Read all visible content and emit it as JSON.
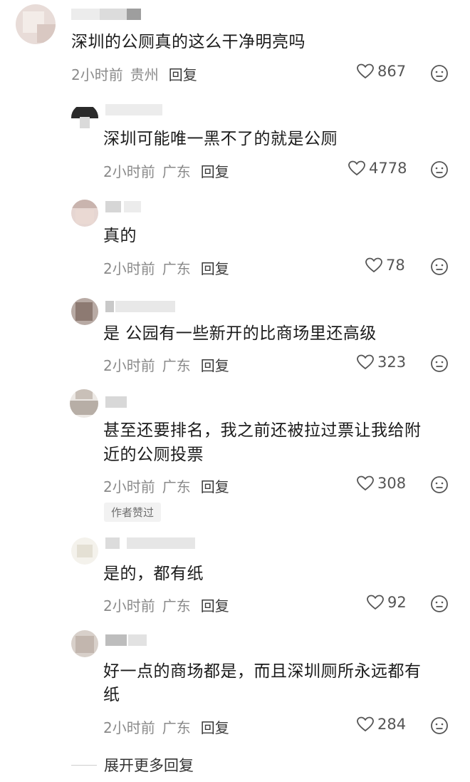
{
  "comments": [
    {
      "text": "深圳的公厕真的这么干净明亮吗",
      "time": "2小时前",
      "location": "贵州",
      "reply_label": "回复",
      "likes": "867"
    },
    {
      "text": "深圳可能唯一黑不了的就是公厕",
      "time": "2小时前",
      "location": "广东",
      "reply_label": "回复",
      "likes": "4778"
    },
    {
      "text": "真的",
      "time": "2小时前",
      "location": "广东",
      "reply_label": "回复",
      "likes": "78"
    },
    {
      "text": "是 公园有一些新开的比商场里还高级",
      "time": "2小时前",
      "location": "广东",
      "reply_label": "回复",
      "likes": "323"
    },
    {
      "text_line1": "甚至还要排名，我之前还被拉过票让我给附",
      "text_line2": "近的公厕投票",
      "time": "2小时前",
      "location": "广东",
      "reply_label": "回复",
      "likes": "308",
      "badge": "作者赞过"
    },
    {
      "text": "是的，都有纸",
      "time": "2小时前",
      "location": "广东",
      "reply_label": "回复",
      "likes": "92"
    },
    {
      "text_line1": "好一点的商场都是，而且深圳厕所永远都有",
      "text_line2": "纸",
      "time": "2小时前",
      "location": "广东",
      "reply_label": "回复",
      "likes": "284"
    }
  ],
  "expand_more": "展开更多回复",
  "icons": {
    "like": "heart-outline-icon",
    "dislike": "neutral-face-icon"
  },
  "colors": {
    "text": "#1b1b1b",
    "meta": "#8a8a8a",
    "badge_bg": "#f2f2f2"
  }
}
